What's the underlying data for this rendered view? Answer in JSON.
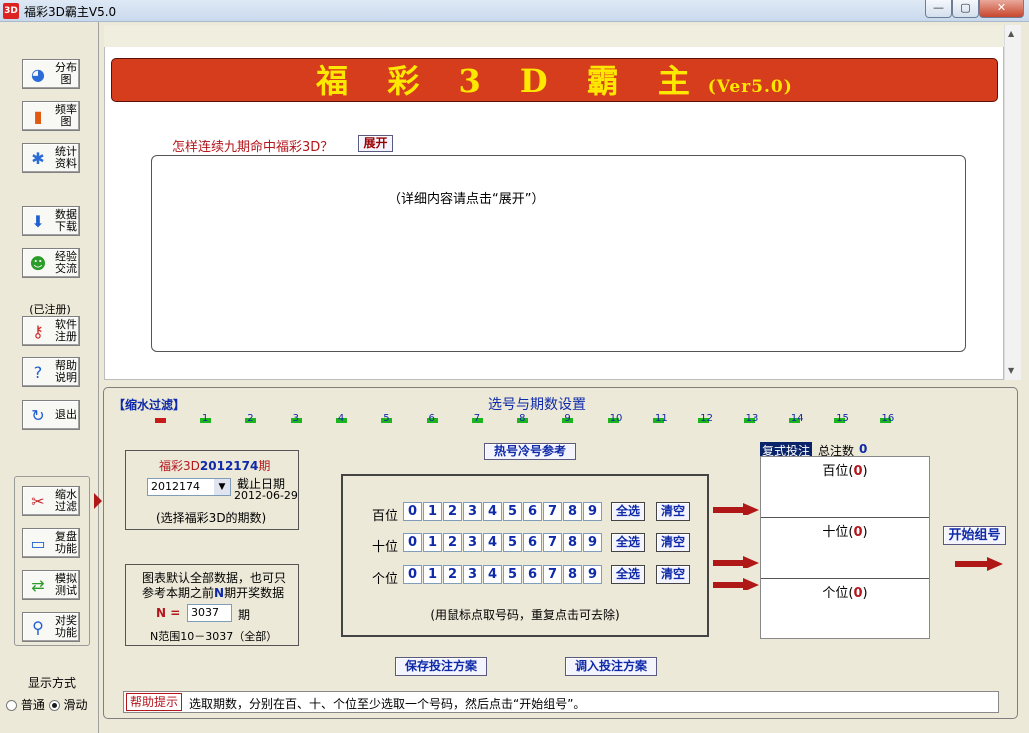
{
  "window": {
    "title": "福彩3D霸主V5.0",
    "icon_text": "3D",
    "btn_min": "—",
    "btn_max": "▢",
    "btn_close": "✕"
  },
  "sidebar": {
    "items": [
      {
        "label1": "分布",
        "label2": "图",
        "icon": "pie-chart-icon",
        "glyph": "◕",
        "color": "#2b6cd6"
      },
      {
        "label1": "频率",
        "label2": "图",
        "icon": "bar-chart-icon",
        "glyph": "▮",
        "color": "#e05a10"
      },
      {
        "label1": "统计",
        "label2": "资料",
        "icon": "gear-icon",
        "glyph": "✱",
        "color": "#2b6cd6"
      },
      {
        "label1": "数据",
        "label2": "下载",
        "icon": "download-icon",
        "glyph": "⬇",
        "color": "#1d5fd1"
      },
      {
        "label1": "经验",
        "label2": "交流",
        "icon": "users-icon",
        "glyph": "☻",
        "color": "#2a9c2a"
      },
      {
        "label1": "软件",
        "label2": "注册",
        "icon": "key-icon",
        "glyph": "⚷",
        "color": "#d12b2b"
      },
      {
        "label1": "帮助",
        "label2": "说明",
        "icon": "help-icon",
        "glyph": "?",
        "color": "#1d5fd1"
      },
      {
        "label1": "退出",
        "label2": "",
        "icon": "exit-icon",
        "glyph": "↻",
        "color": "#1d5fd1"
      }
    ],
    "registered": "(已注册)",
    "lower_items": [
      {
        "label1": "缩水",
        "label2": "过滤",
        "icon": "scissors-icon",
        "glyph": "✂",
        "color": "#c0262c"
      },
      {
        "label1": "复盘",
        "label2": "功能",
        "icon": "replay-icon",
        "glyph": "▭",
        "color": "#1d5fd1"
      },
      {
        "label1": "模拟",
        "label2": "测试",
        "icon": "simulate-icon",
        "glyph": "⇄",
        "color": "#2a9c2a"
      },
      {
        "label1": "对奖",
        "label2": "功能",
        "icon": "check-prize-icon",
        "glyph": "⚲",
        "color": "#1d5fd1"
      }
    ],
    "display_mode": "显示方式",
    "mode_normal": "普通",
    "mode_scroll": "滑动"
  },
  "banner": {
    "title": "福 彩 3 D 霸 主",
    "version": "(Ver5.0)"
  },
  "article": {
    "question": "怎样连续九期命中福彩3D？",
    "expand": "展开",
    "content": "（详细内容请点击“展开”）"
  },
  "filter": {
    "group_label": "【缩水过滤】",
    "settings_title": "选号与期数设置",
    "ruler": [
      "1",
      "2",
      "3",
      "4",
      "5",
      "6",
      "7",
      "8",
      "9",
      "10",
      "11",
      "12",
      "13",
      "14",
      "15",
      "16"
    ],
    "period_prefix": "福彩3D",
    "period_num": "2012174",
    "period_suffix": "期",
    "period_select": "2012174",
    "deadline_label": "截止日期",
    "deadline": "2012-06-29",
    "period_hint": "(选择福彩3D的期数)",
    "default_note1": "图表默认全部数据，也可只",
    "default_note2a": "参考本期之前",
    "default_note2b": "N",
    "default_note2c": "期开奖数据",
    "n_label": "N =",
    "n_value": "3037",
    "n_unit": "期",
    "n_range": "N范围10－3037（全部）",
    "hot_cold": "热号冷号参考",
    "rows": [
      {
        "label": "百位",
        "digits": [
          "0",
          "1",
          "2",
          "3",
          "4",
          "5",
          "6",
          "7",
          "8",
          "9"
        ]
      },
      {
        "label": "十位",
        "digits": [
          "0",
          "1",
          "2",
          "3",
          "4",
          "5",
          "6",
          "7",
          "8",
          "9"
        ]
      },
      {
        "label": "个位",
        "digits": [
          "0",
          "1",
          "2",
          "3",
          "4",
          "5",
          "6",
          "7",
          "8",
          "9"
        ]
      }
    ],
    "select_all": "全选",
    "clear": "清空",
    "mouse_hint": "(用鼠标点取号码，重复点击可去除)",
    "compound_bet": "复式投注",
    "total_label": "总注数",
    "total_value": "0",
    "res_hundreds": "百位(",
    "res_tens": "十位(",
    "res_units": "个位(",
    "res_zero": "0",
    "res_close": ")",
    "start_group": "开始组号",
    "save_plan": "保存投注方案",
    "load_plan": "调入投注方案",
    "help_label": "帮助提示",
    "help_text": "选取期数，分别在百、十、个位至少选取一个号码，然后点击“开始组号”。"
  }
}
